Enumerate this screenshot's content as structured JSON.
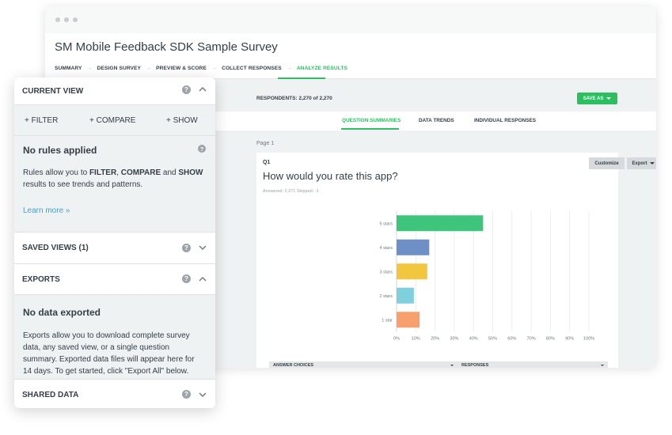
{
  "window": {
    "survey_title": "SM Mobile Feedback SDK Sample Survey",
    "steps": [
      "SUMMARY",
      "DESIGN SURVEY",
      "PREVIEW & SCORE",
      "COLLECT RESPONSES",
      "ANALYZE RESULTS"
    ],
    "active_step": "ANALYZE RESULTS",
    "respondents": "RESPONDENTS: 2,270 of 2,270",
    "save_as_label": "SAVE AS",
    "tabs": [
      "QUESTION SUMMARIES",
      "DATA TRENDS",
      "INDIVIDUAL RESPONSES"
    ],
    "active_tab": "QUESTION SUMMARIES",
    "page_label": "Page 1"
  },
  "question": {
    "number": "Q1",
    "title": "How would you rate this app?",
    "stats": "Answered: 2,271    Skipped: -1",
    "customize_label": "Customize",
    "export_label": "Export",
    "table_headers": [
      "ANSWER CHOICES",
      "RESPONSES"
    ]
  },
  "chart_data": {
    "type": "bar",
    "orientation": "horizontal",
    "categories": [
      "5 stars",
      "4 stars",
      "3 stars",
      "2 stars",
      "1 star"
    ],
    "values": [
      45,
      17,
      16,
      9,
      12
    ],
    "colors": [
      "#3cc57b",
      "#6f8fc7",
      "#f3c63f",
      "#7fd0dc",
      "#f7a06d"
    ],
    "xlim": [
      0,
      100
    ],
    "xticks": [
      "0%",
      "10%",
      "20%",
      "30%",
      "40%",
      "50%",
      "60%",
      "70%",
      "80%",
      "90%",
      "100%"
    ],
    "grid": true,
    "title": "",
    "xlabel": "",
    "ylabel": ""
  },
  "panel": {
    "current_view": {
      "title": "CURRENT VIEW",
      "actions": [
        "+ FILTER",
        "+ COMPARE",
        "+ SHOW"
      ],
      "empty_title": "No rules applied",
      "body_1": "Rules allow you to ",
      "kw_filter": "FILTER",
      "sep": ", ",
      "kw_compare": "COMPARE",
      "and": " and ",
      "kw_show": "SHOW",
      "body_2": "results to see trends and patterns.",
      "learn_more": "Learn more »"
    },
    "saved_views": {
      "title": "SAVED VIEWS (1)"
    },
    "exports": {
      "title": "EXPORTS",
      "empty_title": "No data exported",
      "lines": [
        "Exports allow you to download complete survey",
        "data, any saved view, or a single question",
        "summary. Exported data files will appear here for",
        "14 days. To get started, click \"Export All\" below."
      ]
    },
    "shared_data": {
      "title": "SHARED DATA"
    },
    "help_glyph": "?"
  },
  "colors": {
    "accent": "#2dbe60",
    "link": "#4a9fc8",
    "panel_grey": "#eff2f2"
  }
}
